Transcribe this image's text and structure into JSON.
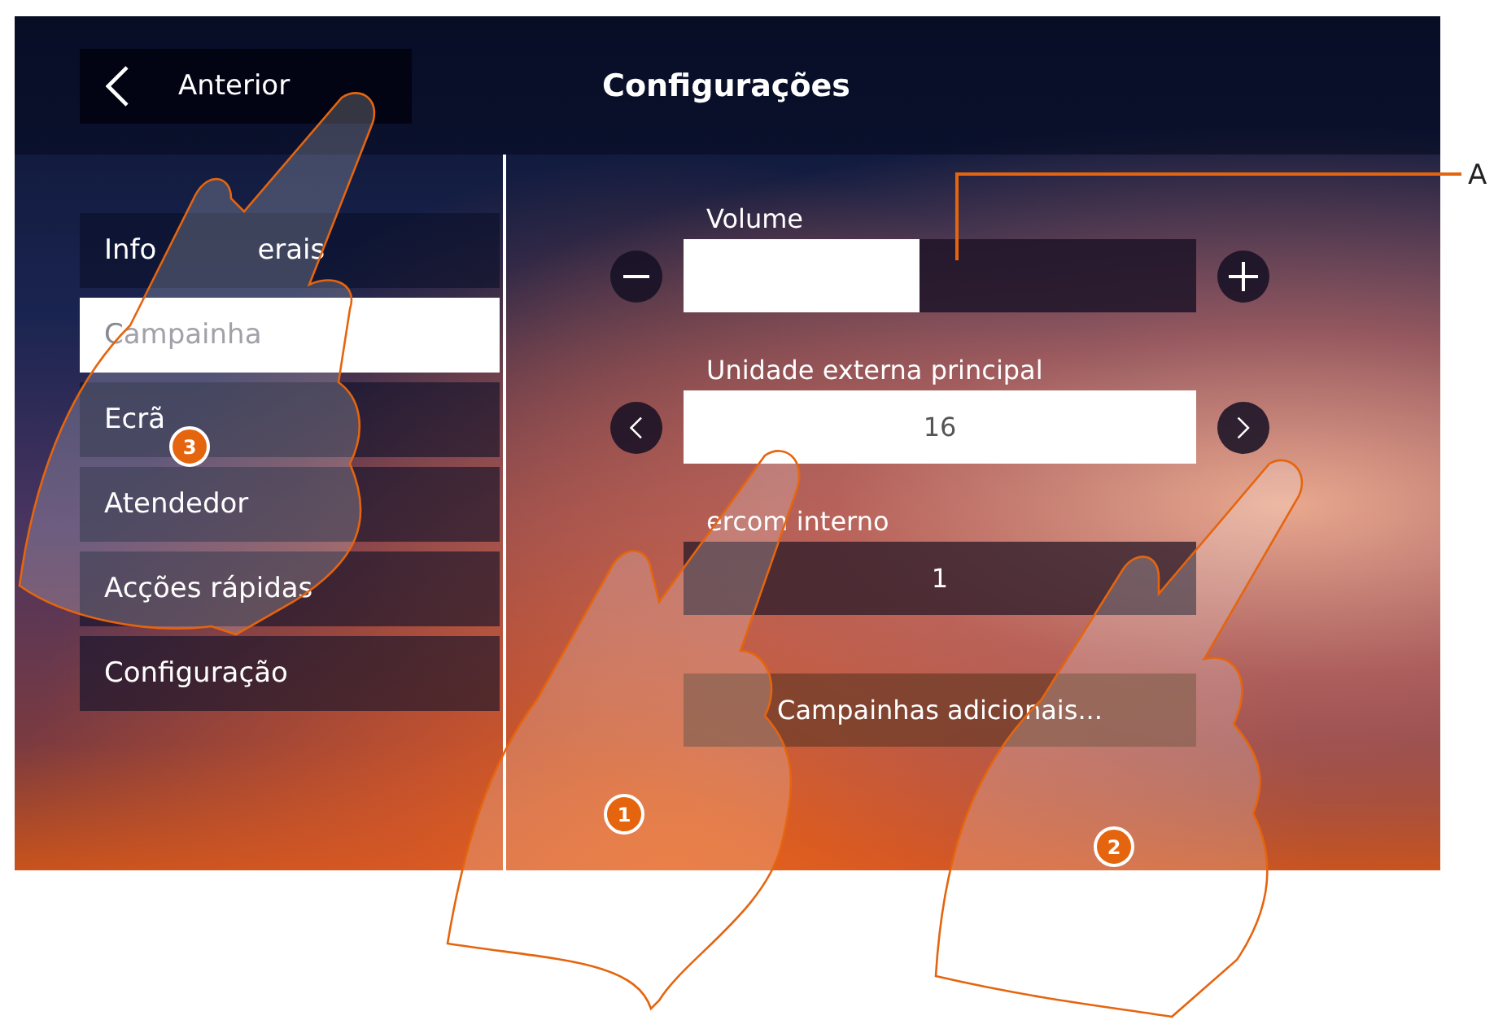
{
  "header": {
    "back_label": "Anterior",
    "title": "Configurações"
  },
  "menu": [
    {
      "label": "Info",
      "label_tail": "erais",
      "selected": false
    },
    {
      "label": "Campainha",
      "selected": true
    },
    {
      "label": "Ecrã",
      "selected": false
    },
    {
      "label": "Atendedor",
      "selected": false
    },
    {
      "label": "Acções rápidas",
      "selected": false
    },
    {
      "label": "Configuração",
      "selected": false
    }
  ],
  "volume": {
    "label": "Volume",
    "level": 0.46
  },
  "external_unit": {
    "label": "Unidade externa principal",
    "value": "16"
  },
  "intercom": {
    "label": "ercom interno",
    "value": "1"
  },
  "additional_button": "Campainhas adicionais...",
  "step_badges": [
    "1",
    "2",
    "3"
  ],
  "callout": "A"
}
